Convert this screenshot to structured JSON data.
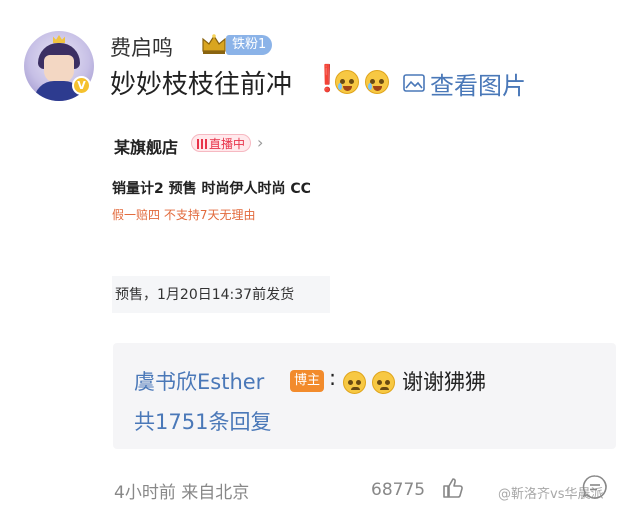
{
  "post": {
    "author": "费启鸣",
    "fan_badge": "铁粉1",
    "text": "妙妙枝枝往前冲",
    "exclaim": "❗",
    "image_link": "查看图片",
    "avatar_badge": "V"
  },
  "screenshot": {
    "store_name": "某旗舰店",
    "live_label": "直播中",
    "sales_line": "销量计2 预售 时尚伊人时尚 CC",
    "policy_line": "假一赔四   不支持7天无理由",
    "ship_line": "预售，1月20日14:37前发货"
  },
  "reply": {
    "user": "虞书欣Esther",
    "host_badge": "博主",
    "colon": ":",
    "text": "谢谢狒狒",
    "count": "共1751条回复"
  },
  "footer": {
    "time_location": "4小时前  来自北京",
    "likes": "68775",
    "watermark": "@靳洛齐vs华晨派"
  },
  "icons": [
    "crown-icon",
    "laugh-cry-emoji-icon",
    "image-icon",
    "chevron-right-icon",
    "sad-emoji-icon",
    "like-icon",
    "comment-icon"
  ],
  "colors": {
    "link_blue": "#4a78b8",
    "exclaim_red": "#e52d2d",
    "host_orange": "#f28b2c",
    "fan_badge_blue": "#8bb3e8"
  }
}
